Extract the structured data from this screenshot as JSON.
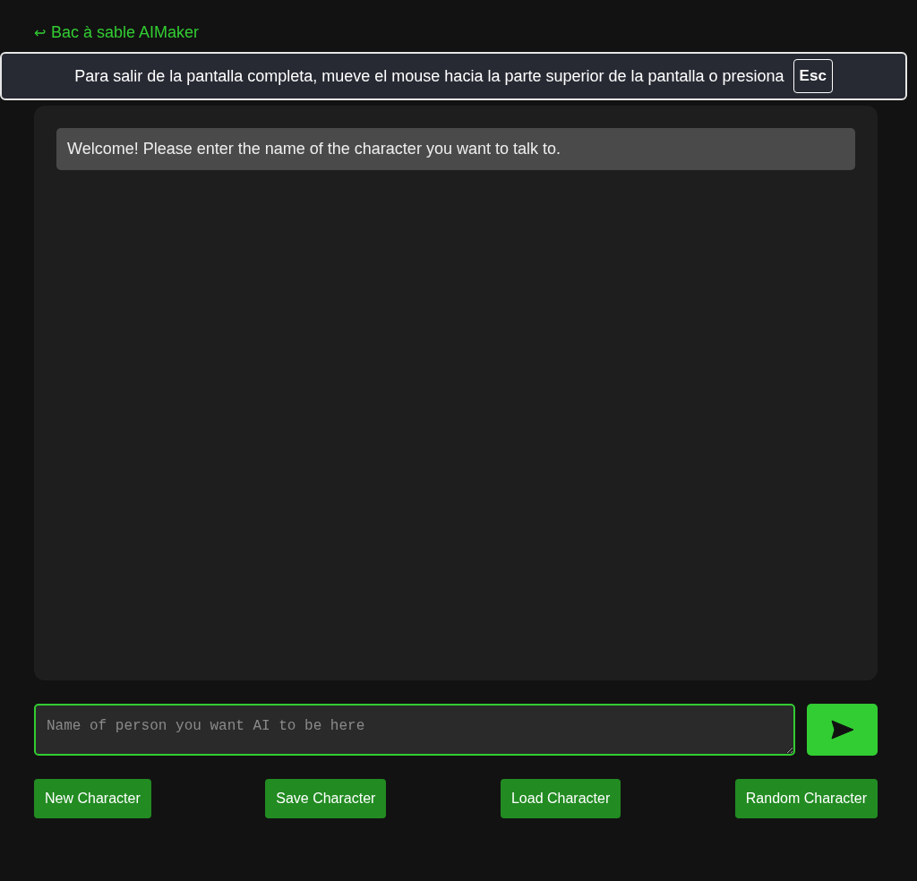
{
  "back_link": {
    "arrow": "↩",
    "label": "Bac à sable AIMaker"
  },
  "fullscreen_notice": {
    "text": "Para salir de la pantalla completa, mueve el mouse hacia la parte superior de la pantalla o presiona",
    "key": "Esc"
  },
  "messages": [
    {
      "kind": "system",
      "text": "Welcome! Please enter the name of the character you want to talk to."
    }
  ],
  "input": {
    "placeholder": "Name of person you want AI to be here"
  },
  "buttons": [
    "New Character",
    "Save Character",
    "Load Character",
    "Random Character"
  ]
}
